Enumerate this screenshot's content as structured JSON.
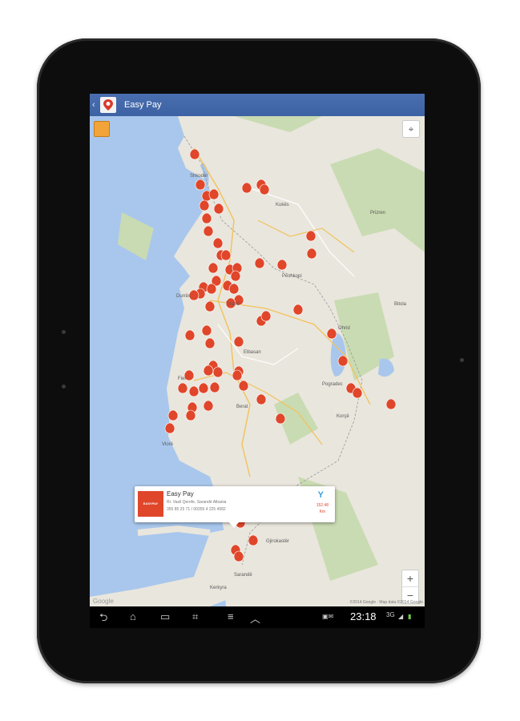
{
  "app": {
    "title": "Easy Pay"
  },
  "map": {
    "places": [
      "Shkodër",
      "Kukës",
      "Peshkopi",
      "Durrës",
      "Tiranë",
      "Elbasan",
      "Berat",
      "Fier",
      "Vlorë",
      "Korçë",
      "Pogradec",
      "Gjirokastër",
      "Sarandë",
      "Ohrid",
      "Bitola",
      "Prizren",
      "Kerkyra"
    ],
    "copyright": "©2014 Google · Map data ©2014 Google",
    "google_label": "Google",
    "pin_color": "#e0462a"
  },
  "info_window": {
    "name": "Easy Pay",
    "address": "Rr. Vasil Qerefe, Sarandë Albania",
    "phone": "355 85 25 71 / 00355 4 225 4582",
    "distance": "152.48",
    "distance_unit": "Km",
    "logo_text": "EASYPAY"
  },
  "status_bar": {
    "time": "23:18",
    "signal": "3G"
  },
  "icons": {
    "back": "back-icon",
    "home": "home-icon",
    "recents": "recents-icon",
    "screenshot": "screenshot-icon",
    "menu": "menu-icon",
    "up": "chevron-up-icon"
  }
}
